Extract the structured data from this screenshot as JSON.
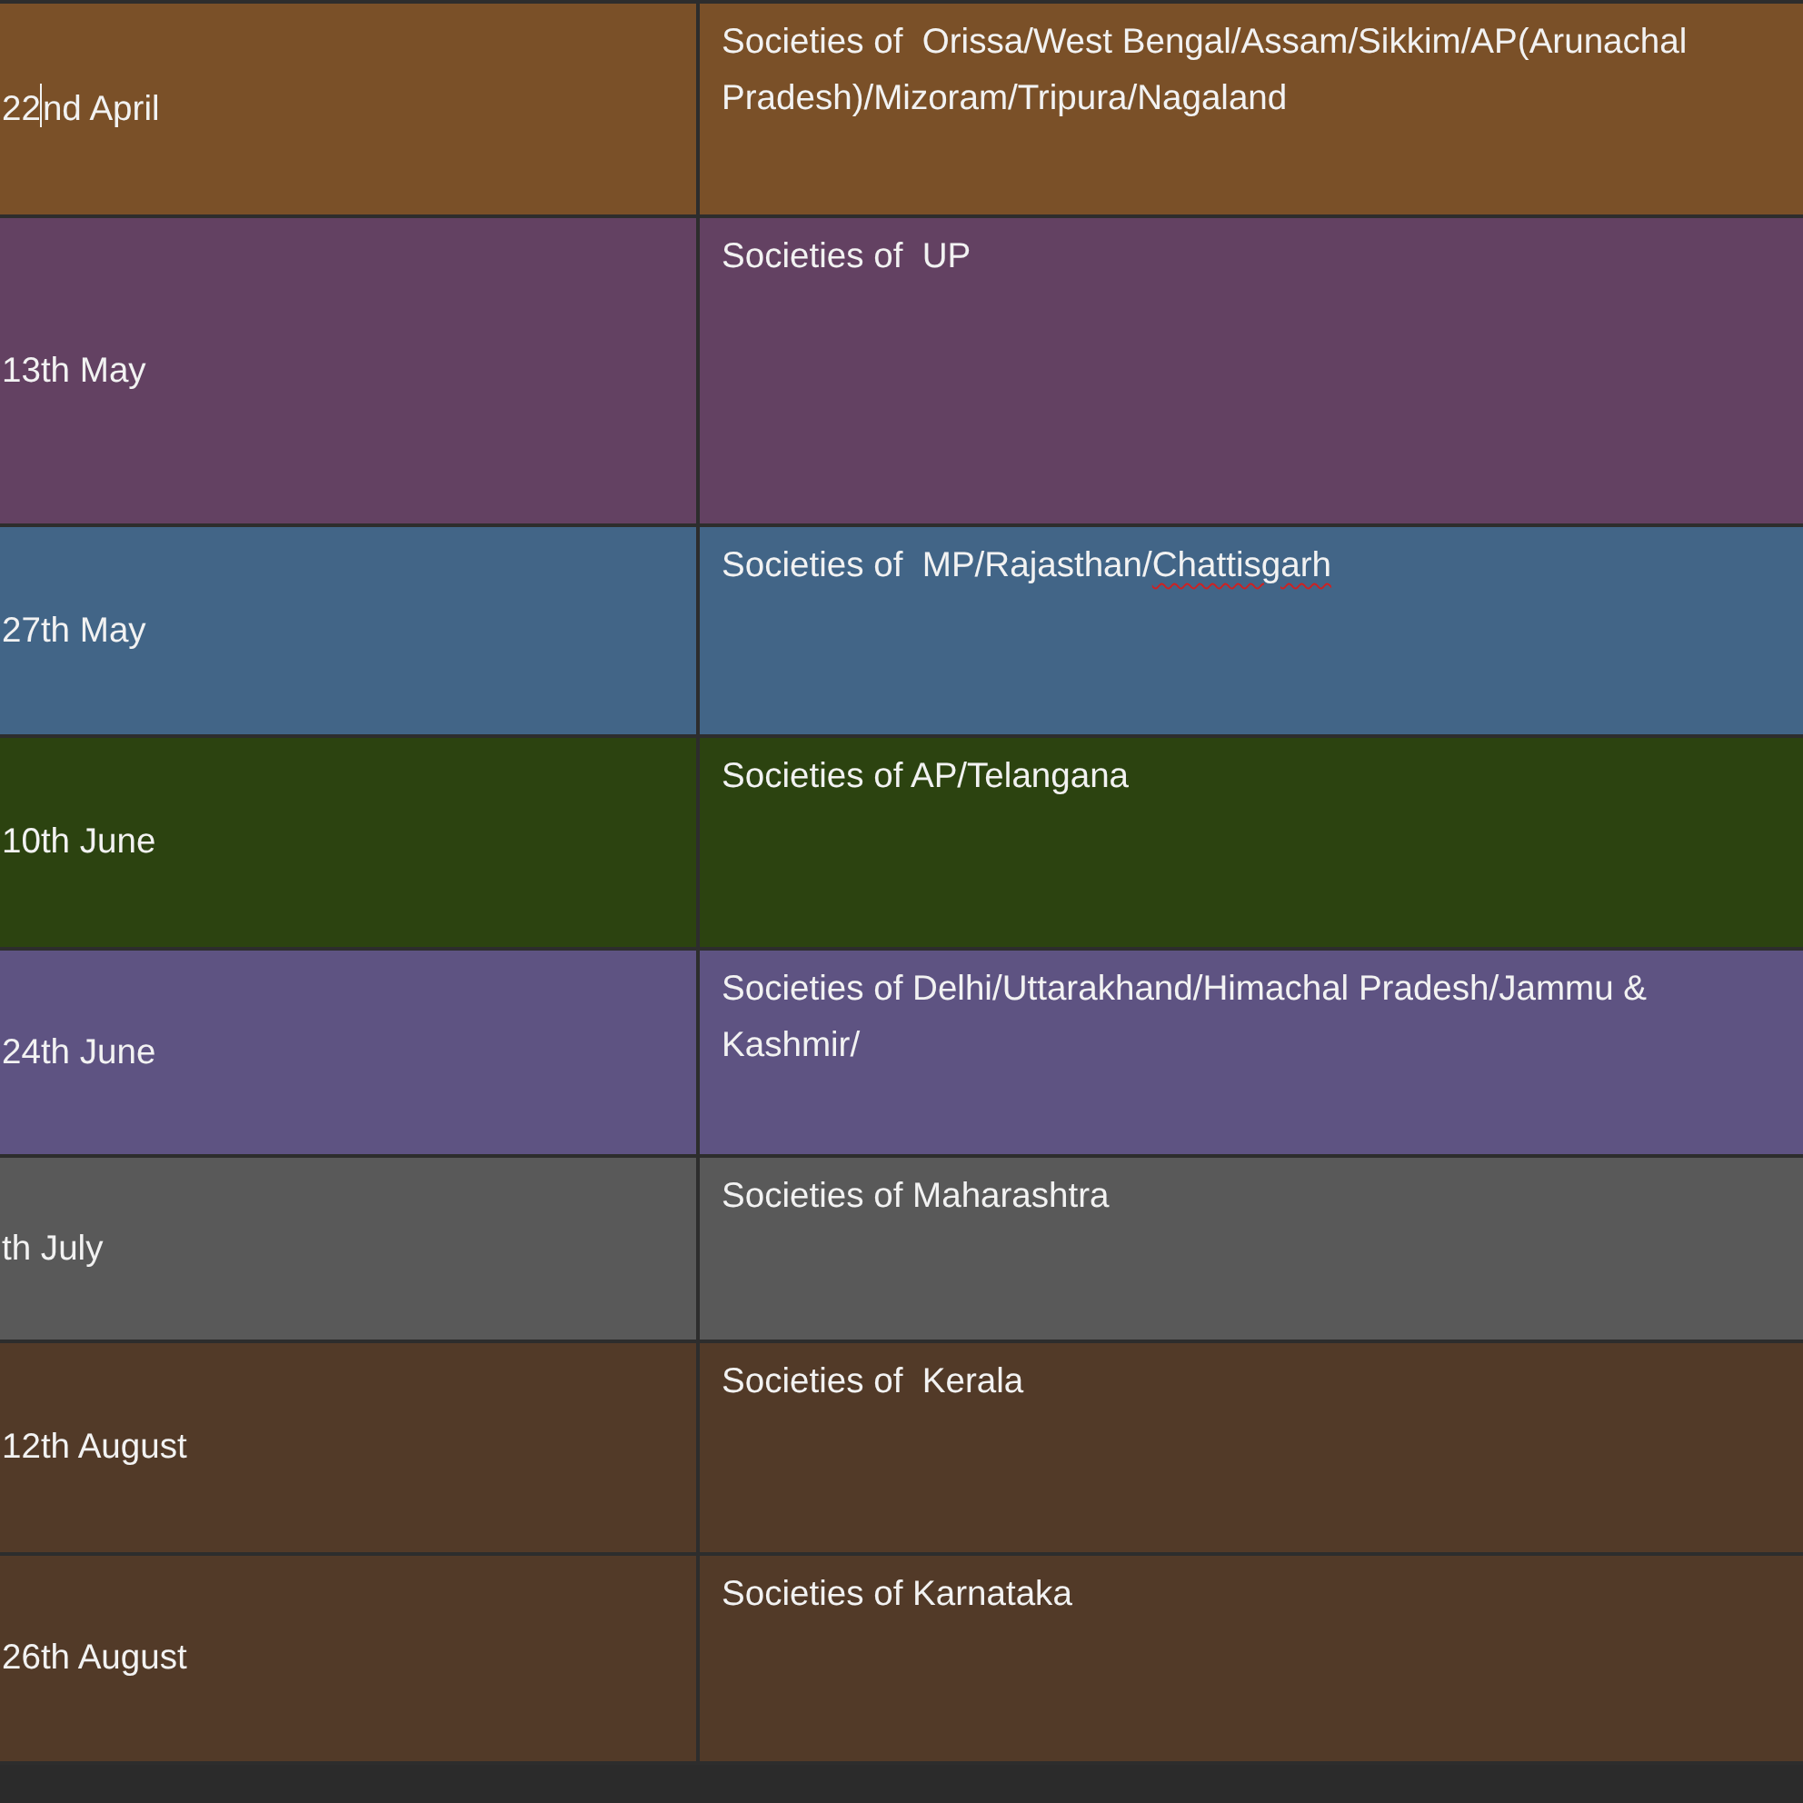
{
  "table": {
    "rows": [
      {
        "color": "#7a5028",
        "date_parts": [
          {
            "text": "22",
            "caret_after": true
          },
          {
            "text": "nd April",
            "caret_after": false
          }
        ],
        "text_parts": [
          {
            "text": "Societies of  Orissa/West Bengal/Assam/Sikkim/AP(Arunachal Pradesh)/Mizoram/Tripura/Nagaland",
            "flagged": false
          }
        ]
      },
      {
        "color": "#634162",
        "date_parts": [
          {
            "text": "13th May",
            "caret_after": false
          }
        ],
        "text_parts": [
          {
            "text": "Societies of  UP",
            "flagged": false
          }
        ]
      },
      {
        "color": "#426587",
        "date_parts": [
          {
            "text": "27th May",
            "caret_after": false
          }
        ],
        "text_parts": [
          {
            "text": "Societies of  MP/Rajasthan/",
            "flagged": false
          },
          {
            "text": "Chattisgarh",
            "flagged": true
          }
        ]
      },
      {
        "color": "#2c4310",
        "date_parts": [
          {
            "text": "10th June",
            "caret_after": false
          }
        ],
        "text_parts": [
          {
            "text": "Societies of AP/Telangana",
            "flagged": false
          }
        ]
      },
      {
        "color": "#5e5382",
        "date_parts": [
          {
            "text": "24th June",
            "caret_after": false
          }
        ],
        "text_parts": [
          {
            "text": "Societies of Delhi/Uttarakhand/Himachal Pradesh/Jammu & Kashmir/",
            "flagged": false
          }
        ]
      },
      {
        "color": "#595959",
        "date_parts": [
          {
            "text": "th July",
            "caret_after": false
          }
        ],
        "text_parts": [
          {
            "text": "Societies of Maharashtra",
            "flagged": false
          }
        ]
      },
      {
        "color": "#523a28",
        "date_parts": [
          {
            "text": "12th August",
            "caret_after": false
          }
        ],
        "text_parts": [
          {
            "text": "Societies of  Kerala",
            "flagged": false
          }
        ]
      },
      {
        "color": "#523a28",
        "date_parts": [
          {
            "text": "26th August",
            "caret_after": false
          }
        ],
        "text_parts": [
          {
            "text": "Societies of Karnataka",
            "flagged": false
          }
        ]
      }
    ]
  }
}
